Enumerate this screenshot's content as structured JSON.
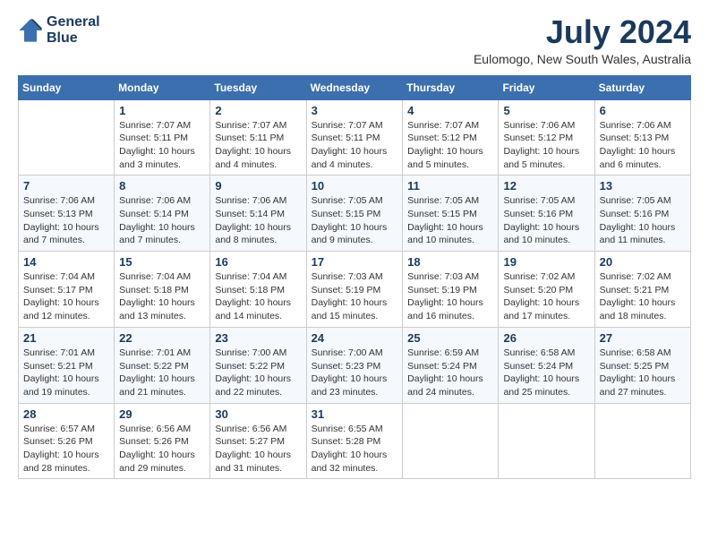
{
  "header": {
    "logo_line1": "General",
    "logo_line2": "Blue",
    "month": "July 2024",
    "location": "Eulomogo, New South Wales, Australia"
  },
  "weekdays": [
    "Sunday",
    "Monday",
    "Tuesday",
    "Wednesday",
    "Thursday",
    "Friday",
    "Saturday"
  ],
  "weeks": [
    [
      {
        "day": "",
        "sunrise": "",
        "sunset": "",
        "daylight": ""
      },
      {
        "day": "1",
        "sunrise": "Sunrise: 7:07 AM",
        "sunset": "Sunset: 5:11 PM",
        "daylight": "Daylight: 10 hours and 3 minutes."
      },
      {
        "day": "2",
        "sunrise": "Sunrise: 7:07 AM",
        "sunset": "Sunset: 5:11 PM",
        "daylight": "Daylight: 10 hours and 4 minutes."
      },
      {
        "day": "3",
        "sunrise": "Sunrise: 7:07 AM",
        "sunset": "Sunset: 5:11 PM",
        "daylight": "Daylight: 10 hours and 4 minutes."
      },
      {
        "day": "4",
        "sunrise": "Sunrise: 7:07 AM",
        "sunset": "Sunset: 5:12 PM",
        "daylight": "Daylight: 10 hours and 5 minutes."
      },
      {
        "day": "5",
        "sunrise": "Sunrise: 7:06 AM",
        "sunset": "Sunset: 5:12 PM",
        "daylight": "Daylight: 10 hours and 5 minutes."
      },
      {
        "day": "6",
        "sunrise": "Sunrise: 7:06 AM",
        "sunset": "Sunset: 5:13 PM",
        "daylight": "Daylight: 10 hours and 6 minutes."
      }
    ],
    [
      {
        "day": "7",
        "sunrise": "Sunrise: 7:06 AM",
        "sunset": "Sunset: 5:13 PM",
        "daylight": "Daylight: 10 hours and 7 minutes."
      },
      {
        "day": "8",
        "sunrise": "Sunrise: 7:06 AM",
        "sunset": "Sunset: 5:14 PM",
        "daylight": "Daylight: 10 hours and 7 minutes."
      },
      {
        "day": "9",
        "sunrise": "Sunrise: 7:06 AM",
        "sunset": "Sunset: 5:14 PM",
        "daylight": "Daylight: 10 hours and 8 minutes."
      },
      {
        "day": "10",
        "sunrise": "Sunrise: 7:05 AM",
        "sunset": "Sunset: 5:15 PM",
        "daylight": "Daylight: 10 hours and 9 minutes."
      },
      {
        "day": "11",
        "sunrise": "Sunrise: 7:05 AM",
        "sunset": "Sunset: 5:15 PM",
        "daylight": "Daylight: 10 hours and 10 minutes."
      },
      {
        "day": "12",
        "sunrise": "Sunrise: 7:05 AM",
        "sunset": "Sunset: 5:16 PM",
        "daylight": "Daylight: 10 hours and 10 minutes."
      },
      {
        "day": "13",
        "sunrise": "Sunrise: 7:05 AM",
        "sunset": "Sunset: 5:16 PM",
        "daylight": "Daylight: 10 hours and 11 minutes."
      }
    ],
    [
      {
        "day": "14",
        "sunrise": "Sunrise: 7:04 AM",
        "sunset": "Sunset: 5:17 PM",
        "daylight": "Daylight: 10 hours and 12 minutes."
      },
      {
        "day": "15",
        "sunrise": "Sunrise: 7:04 AM",
        "sunset": "Sunset: 5:18 PM",
        "daylight": "Daylight: 10 hours and 13 minutes."
      },
      {
        "day": "16",
        "sunrise": "Sunrise: 7:04 AM",
        "sunset": "Sunset: 5:18 PM",
        "daylight": "Daylight: 10 hours and 14 minutes."
      },
      {
        "day": "17",
        "sunrise": "Sunrise: 7:03 AM",
        "sunset": "Sunset: 5:19 PM",
        "daylight": "Daylight: 10 hours and 15 minutes."
      },
      {
        "day": "18",
        "sunrise": "Sunrise: 7:03 AM",
        "sunset": "Sunset: 5:19 PM",
        "daylight": "Daylight: 10 hours and 16 minutes."
      },
      {
        "day": "19",
        "sunrise": "Sunrise: 7:02 AM",
        "sunset": "Sunset: 5:20 PM",
        "daylight": "Daylight: 10 hours and 17 minutes."
      },
      {
        "day": "20",
        "sunrise": "Sunrise: 7:02 AM",
        "sunset": "Sunset: 5:21 PM",
        "daylight": "Daylight: 10 hours and 18 minutes."
      }
    ],
    [
      {
        "day": "21",
        "sunrise": "Sunrise: 7:01 AM",
        "sunset": "Sunset: 5:21 PM",
        "daylight": "Daylight: 10 hours and 19 minutes."
      },
      {
        "day": "22",
        "sunrise": "Sunrise: 7:01 AM",
        "sunset": "Sunset: 5:22 PM",
        "daylight": "Daylight: 10 hours and 21 minutes."
      },
      {
        "day": "23",
        "sunrise": "Sunrise: 7:00 AM",
        "sunset": "Sunset: 5:22 PM",
        "daylight": "Daylight: 10 hours and 22 minutes."
      },
      {
        "day": "24",
        "sunrise": "Sunrise: 7:00 AM",
        "sunset": "Sunset: 5:23 PM",
        "daylight": "Daylight: 10 hours and 23 minutes."
      },
      {
        "day": "25",
        "sunrise": "Sunrise: 6:59 AM",
        "sunset": "Sunset: 5:24 PM",
        "daylight": "Daylight: 10 hours and 24 minutes."
      },
      {
        "day": "26",
        "sunrise": "Sunrise: 6:58 AM",
        "sunset": "Sunset: 5:24 PM",
        "daylight": "Daylight: 10 hours and 25 minutes."
      },
      {
        "day": "27",
        "sunrise": "Sunrise: 6:58 AM",
        "sunset": "Sunset: 5:25 PM",
        "daylight": "Daylight: 10 hours and 27 minutes."
      }
    ],
    [
      {
        "day": "28",
        "sunrise": "Sunrise: 6:57 AM",
        "sunset": "Sunset: 5:26 PM",
        "daylight": "Daylight: 10 hours and 28 minutes."
      },
      {
        "day": "29",
        "sunrise": "Sunrise: 6:56 AM",
        "sunset": "Sunset: 5:26 PM",
        "daylight": "Daylight: 10 hours and 29 minutes."
      },
      {
        "day": "30",
        "sunrise": "Sunrise: 6:56 AM",
        "sunset": "Sunset: 5:27 PM",
        "daylight": "Daylight: 10 hours and 31 minutes."
      },
      {
        "day": "31",
        "sunrise": "Sunrise: 6:55 AM",
        "sunset": "Sunset: 5:28 PM",
        "daylight": "Daylight: 10 hours and 32 minutes."
      },
      {
        "day": "",
        "sunrise": "",
        "sunset": "",
        "daylight": ""
      },
      {
        "day": "",
        "sunrise": "",
        "sunset": "",
        "daylight": ""
      },
      {
        "day": "",
        "sunrise": "",
        "sunset": "",
        "daylight": ""
      }
    ]
  ]
}
